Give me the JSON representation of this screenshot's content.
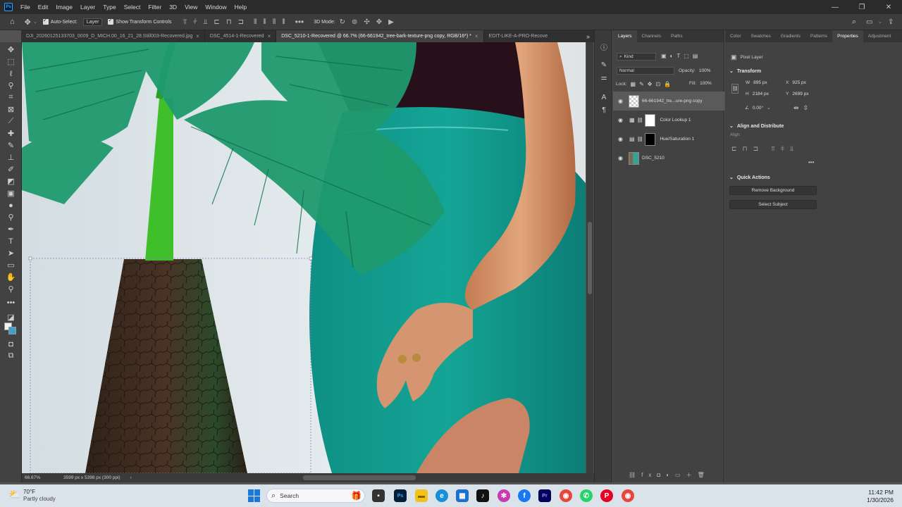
{
  "menu": [
    "File",
    "Edit",
    "Image",
    "Layer",
    "Type",
    "Select",
    "Filter",
    "3D",
    "View",
    "Window",
    "Help"
  ],
  "app_logo": "Ps",
  "options": {
    "auto_select_label": "Auto-Select:",
    "auto_select_value": "Layer",
    "show_transform_label": "Show Transform Controls",
    "mode_3d": "3D Mode:"
  },
  "tabs": [
    {
      "label": "DJI_20260125133703_0009_D_MICH.00_16_21_28.Still003-Recovered.jpg",
      "active": false,
      "close": "×"
    },
    {
      "label": "DSC_4514-1-Recovered",
      "active": false,
      "close": "×"
    },
    {
      "label": "DSC_5210-1-Recovered @ 66.7% (66-661942_tree-bark-texture-png copy, RGB/16*) *",
      "active": true,
      "close": "×"
    },
    {
      "label": "EDIT-LIKE-A-PRO-Recove",
      "active": false,
      "close": ""
    }
  ],
  "tabs_overflow": "»",
  "status": {
    "zoom": "66.67%",
    "dimensions": "3599 px x 5398 px (300 ppi)",
    "arrow": "›"
  },
  "layers_panel": {
    "tabs": [
      "Layers",
      "Channels",
      "Paths"
    ],
    "kind": "Kind",
    "blend_mode": "Normal",
    "opacity_label": "Opacity:",
    "opacity_value": "100%",
    "lock_label": "Lock:",
    "fill_label": "Fill:",
    "fill_value": "100%",
    "layers": [
      {
        "name": "66-661942_tre...ure-png copy",
        "selected": true,
        "thumb_color": "#d8d8d8"
      },
      {
        "name": "Color Lookup 1",
        "selected": false,
        "thumb_color": "#ffffff"
      },
      {
        "name": "Hue/Saturation 1",
        "selected": false,
        "thumb_color": "#000000"
      },
      {
        "name": "DSC_5210",
        "selected": false,
        "thumb_color": "#6f8a7d"
      }
    ]
  },
  "props_panel": {
    "tabs": [
      "Color",
      "Swatches",
      "Gradients",
      "Patterns",
      "Properties",
      "Adjustment"
    ],
    "pixel_layer": "Pixel Layer",
    "transform_title": "Transform",
    "w_label": "W",
    "w_value": "895 px",
    "x_label": "X",
    "x_value": "925 px",
    "h_label": "H",
    "h_value": "2184 px",
    "y_label": "Y",
    "y_value": "2699 px",
    "angle_value": "0.00°",
    "align_title": "Align and Distribute",
    "align_label": "Align:",
    "more": "•••",
    "quick_title": "Quick Actions",
    "remove_bg": "Remove Background",
    "select_subject": "Select Subject"
  },
  "taskbar": {
    "weather_temp": "70°F",
    "weather_desc": "Partly cloudy",
    "search_placeholder": "Search",
    "time": "11:42 PM",
    "date": "1/30/2026"
  }
}
